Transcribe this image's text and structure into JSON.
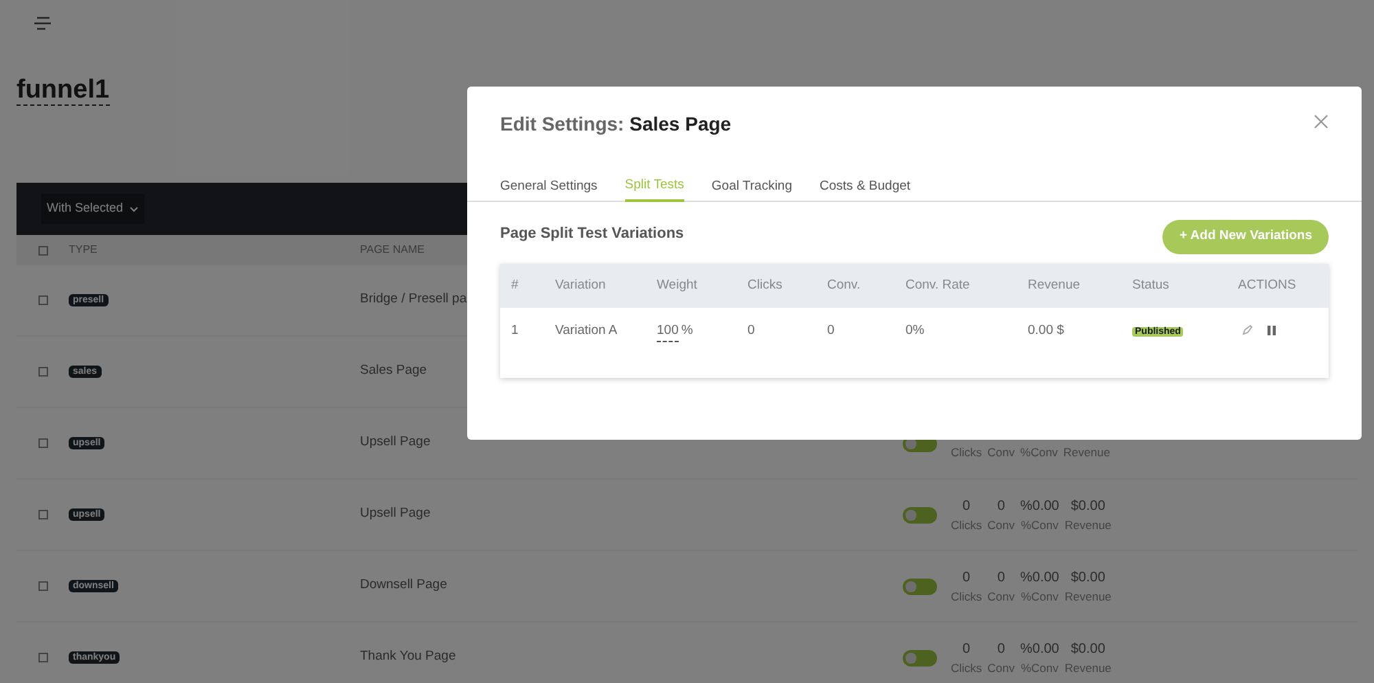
{
  "page": {
    "title": "funnel1",
    "bulk_action": "With Selected",
    "select_all_checked": false,
    "columns": [
      "TYPE",
      "PAGE NAME"
    ],
    "rows": [
      {
        "type": "presell",
        "page_name": "Bridge / Presell pa",
        "checked": false
      },
      {
        "type": "sales",
        "page_name": "Sales Page",
        "checked": false
      },
      {
        "type": "upsell",
        "page_name": "Upsell Page",
        "checked": false,
        "enabled": false,
        "stats": [
          {
            "label": "Clicks"
          },
          {
            "label": "Conv"
          },
          {
            "label": "%Conv"
          },
          {
            "label": "Revenue"
          }
        ]
      },
      {
        "type": "upsell",
        "page_name": "Upsell Page",
        "checked": false,
        "enabled": false,
        "stats": [
          {
            "value": "0",
            "label": "Clicks"
          },
          {
            "value": "0",
            "label": "Conv"
          },
          {
            "value": "%0.00",
            "label": "%Conv"
          },
          {
            "value": "$0.00",
            "label": "Revenue"
          }
        ]
      },
      {
        "type": "downsell",
        "page_name": "Downsell Page",
        "checked": false,
        "enabled": false,
        "stats": [
          {
            "value": "0",
            "label": "Clicks"
          },
          {
            "value": "0",
            "label": "Conv"
          },
          {
            "value": "%0.00",
            "label": "%Conv"
          },
          {
            "value": "$0.00",
            "label": "Revenue"
          }
        ]
      },
      {
        "type": "thankyou",
        "page_name": "Thank You Page",
        "checked": false,
        "enabled": false,
        "stats": [
          {
            "value": "0",
            "label": "Clicks"
          },
          {
            "value": "0",
            "label": "Conv"
          },
          {
            "value": "%0.00",
            "label": "%Conv"
          },
          {
            "value": "$0.00",
            "label": "Revenue"
          }
        ]
      }
    ]
  },
  "modal": {
    "title_prefix": "Edit Settings:",
    "title": "Sales Page",
    "tabs": [
      {
        "label": "General Settings",
        "selected": false
      },
      {
        "label": "Split Tests",
        "selected": true
      },
      {
        "label": "Goal Tracking",
        "selected": false
      },
      {
        "label": "Costs & Budget",
        "selected": false
      }
    ],
    "section_title": "Page Split Test Variations",
    "add_button": "+ Add New Variations",
    "columns": [
      "#",
      "Variation",
      "Weight",
      "Clicks",
      "Conv.",
      "Conv. Rate",
      "Revenue",
      "Status",
      "ACTIONS"
    ],
    "rows": [
      {
        "number": "1",
        "variation": "Variation A",
        "weight": "100",
        "weight_unit": "%",
        "clicks": "0",
        "conv": "0",
        "conv_rate": "0%",
        "revenue": "0.00 $",
        "status": {
          "label": "Published",
          "kind": "published"
        }
      }
    ]
  }
}
